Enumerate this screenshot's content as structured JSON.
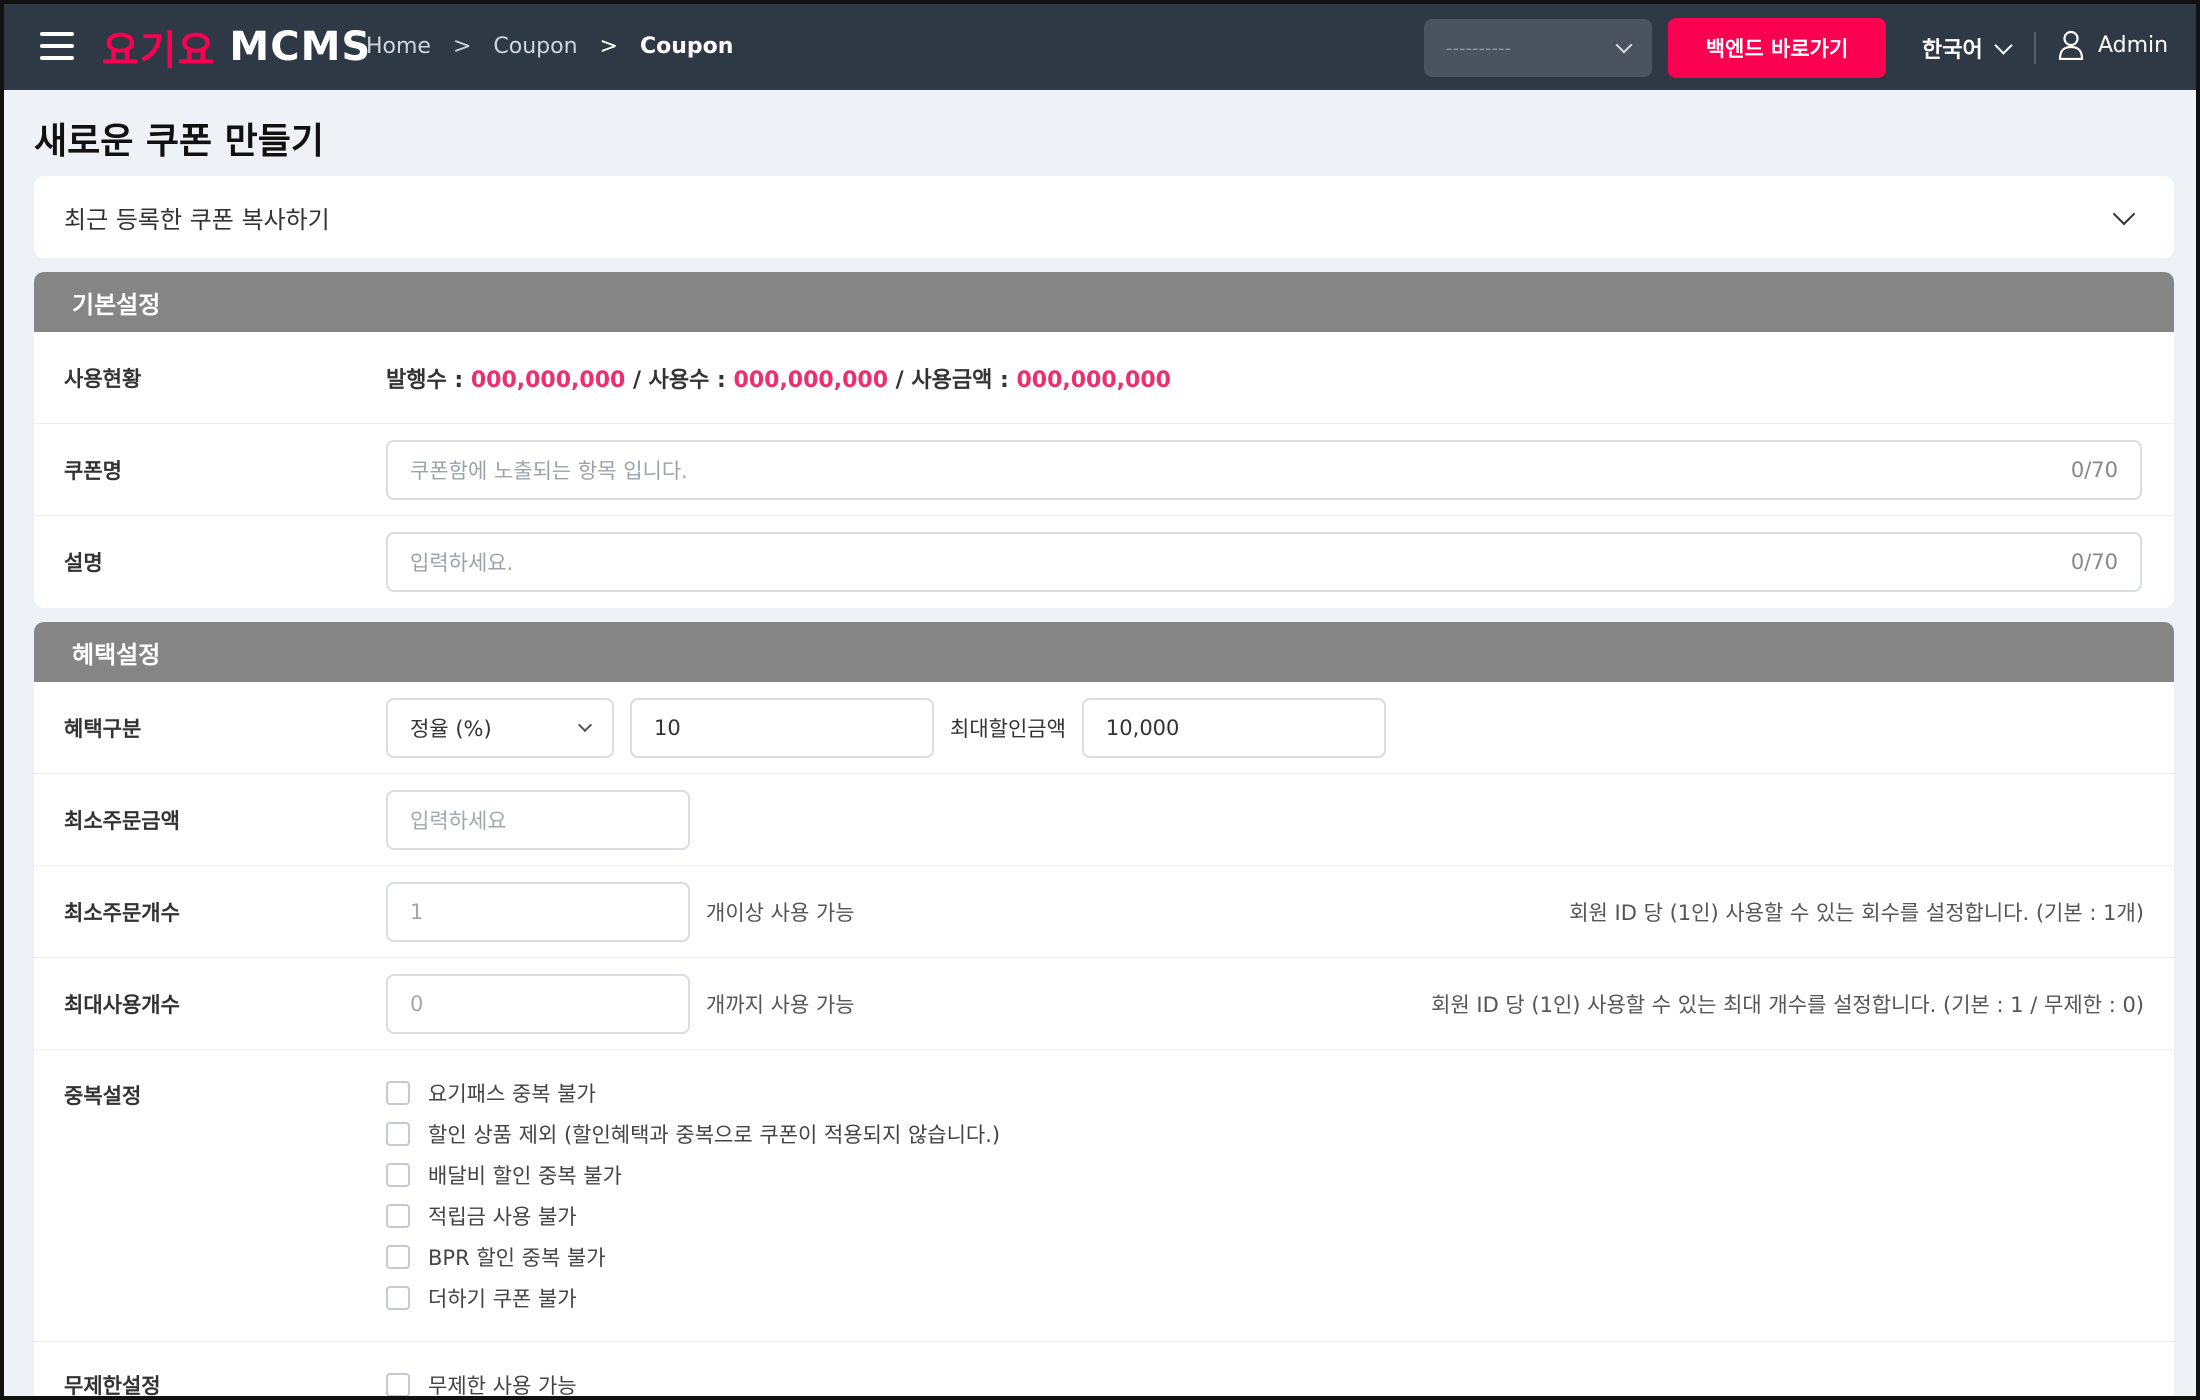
{
  "header": {
    "brand": "요기요",
    "product": "MCMS",
    "breadcrumb": [
      "Home",
      "Coupon",
      "Coupon"
    ],
    "site_select_placeholder": "----------",
    "backend_button": "백엔드 바로가기",
    "language": "한국어",
    "user": "Admin",
    "accent_color": "#fa0050"
  },
  "page": {
    "title": "새로운 쿠폰 만들기",
    "copy_recent": "최근 등록한 쿠폰 복사하기"
  },
  "basic": {
    "section_title": "기본설정",
    "usage_label": "사용현황",
    "issued_label": "발행수 : ",
    "issued_value": "000,000,000",
    "used_label": " / 사용수 : ",
    "used_value": "000,000,000",
    "amount_label": " / 사용금액 : ",
    "amount_value": "000,000,000",
    "coupon_name_label": "쿠폰명",
    "coupon_name_placeholder": "쿠폰함에 노출되는 항목 입니다.",
    "coupon_name_count": "0/70",
    "description_label": "설명",
    "description_placeholder": "입력하세요.",
    "description_count": "0/70"
  },
  "benefit": {
    "section_title": "혜택설정",
    "type_label": "혜택구분",
    "type_value": "정율 (%)",
    "rate_value": "10",
    "max_discount_label": "최대할인금액",
    "max_discount_value": "10,000",
    "min_order_amount_label": "최소주문금액",
    "min_order_amount_placeholder": "입력하세요",
    "min_order_count_label": "최소주문개수",
    "min_order_count_placeholder": "1",
    "min_order_count_suffix": "개이상 사용 가능",
    "min_order_count_hint": "회원 ID 당 (1인) 사용할 수 있는 회수를 설정합니다. (기본 : 1개)",
    "max_use_label": "최대사용개수",
    "max_use_placeholder": "0",
    "max_use_suffix": "개까지 사용 가능",
    "max_use_hint": "회원 ID 당 (1인) 사용할 수 있는 최대 개수를 설정합니다. (기본 : 1 / 무제한 : 0)",
    "duplicate_label": "중복설정",
    "duplicate_options": [
      "요기패스 중복 불가",
      "할인 상품 제외 (할인혜택과 중복으로 쿠폰이 적용되지 않습니다.)",
      "배달비 할인 중복 불가",
      "적립금 사용 불가",
      "BPR 할인 중복 불가",
      "더하기 쿠폰 불가"
    ],
    "unlimited_label": "무제한설정",
    "unlimited_option": "무제한 사용 가능"
  }
}
